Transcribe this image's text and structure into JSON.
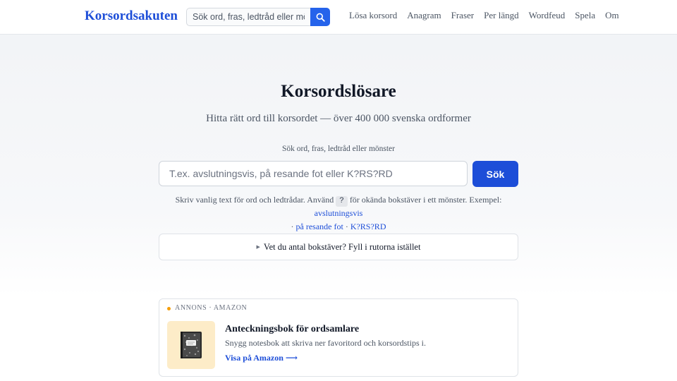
{
  "header": {
    "brand": "Korsordsakuten",
    "search_placeholder": "Sök ord, fras, ledtråd eller mönster",
    "nav": [
      "Lösa korsord",
      "Anagram",
      "Fraser",
      "Per längd",
      "Wordfeud",
      "Spela",
      "Om"
    ]
  },
  "hero": {
    "title": "Korsordslösare",
    "subtitle": "Hitta rätt ord till korsordet — över 400 000 svenska ordformer",
    "search_label": "Sök ord, fras, ledtråd eller mönster",
    "search_placeholder": "T.ex. avslutningsvis, på resande fot eller K?RS?RD",
    "search_button": "Sök",
    "help_before": "Skriv vanlig text för ord och ledtrådar. Använd",
    "help_wildcard": "?",
    "help_after": "för okända bokstäver i ett mönster. Exempel:",
    "examples": [
      "avslutningsvis",
      "på resande fot",
      "K?RS?RD"
    ],
    "example_separator": "·"
  },
  "tip": {
    "label": "Vet du antal bokstäver? Fyll i rutorna istället"
  },
  "ad": {
    "label": "ANNONS · AMAZON",
    "title": "Anteckningsbok för ordsamlare",
    "description": "Snygg notesbok att skriva ner favoritord och korsordstips i.",
    "link": "Visa på Amazon ⟶"
  },
  "colors": {
    "accent": "#1d4ed8",
    "ad_dot": "#f59e0b",
    "ad_thumb_bg": "#fdecc8"
  },
  "icons": {
    "search": "search-icon",
    "tip_arrow": "caret-right-icon",
    "ad_image": "notebook-icon"
  }
}
